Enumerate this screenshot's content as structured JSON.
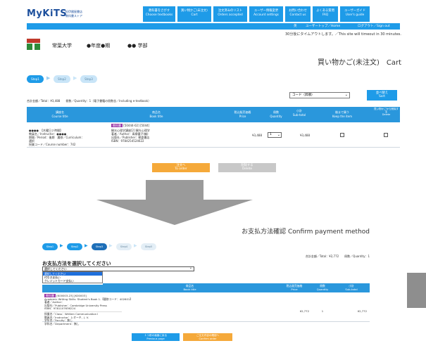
{
  "header": {
    "logo_text": "MyKiTS",
    "logo_sub": [
      "紀伊國屋書店",
      "教科書ストア"
    ],
    "nav": [
      {
        "label": "教科書をさがす\nChoose textbooks"
      },
      {
        "label": "買い物かご(未注文)\nCart"
      },
      {
        "label": "注文済みのリスト\nOrders accepted"
      },
      {
        "label": "ユーザー情報変更\nAccount settings"
      },
      {
        "label": "お問い合わせ\nContact us"
      },
      {
        "label": "よくある質問\nFAQ"
      },
      {
        "label": "ユーザーガイド\nUser's guide"
      }
    ],
    "subnav": [
      "英",
      "ユーザートップ／Home",
      "ログアウト／Sign out"
    ]
  },
  "timeout_notice": "30分後にタイムアウトします。／This site will timeout in 30 minutes.",
  "school": {
    "name": "常葉大学",
    "term": "●年度●期",
    "faculty": "●● 学部"
  },
  "cart_page": {
    "title": "買い物かご(未注文)　Cart",
    "steps": [
      "Step1",
      "Step2",
      "Step3"
    ],
    "sort_select": "コード（昇順）",
    "sort_button": "並べ替え\nSort",
    "total_line": "合計金額／Total：¥3,488　　冊数／Quantity：1（電子書籍の冊数含／Including e-textbook）",
    "columns": [
      "講座名\nCourse title",
      "商品名\nBook title",
      "税込販売価格\nPrice",
      "冊数\nQuantity",
      "小計\nSub-total",
      "後まで買う\nKeep the item",
      "買い物かごから削除する\nDelete"
    ],
    "row": {
      "course": [
        "●●●●　【木曜日２時間】",
        "教員名／Instructor：●●●●",
        "期間／Period：後期　履修／Curriculum：",
        "選択",
        "授業コード／Course number：742"
      ],
      "badge": "教科書",
      "codes": "[50444-02] [5044]",
      "book": [
        "観光心理学講座[2] 観光心理学",
        "著者／Author：青柳優子(編)",
        "出版社／Publisher：朝倉書店",
        "ISBN：9784254524622"
      ],
      "price": "¥3,488",
      "qty": "1",
      "subtotal": "¥3,488"
    },
    "order_button": "注文へ\nTo order",
    "delete_button": "削除する\nDelete"
  },
  "payment_page": {
    "title": "お支払方法確認 Confirm payment method",
    "steps": [
      "Step1",
      "Step2",
      "Step3",
      "Step4",
      "Step5"
    ],
    "total_line": "合計金額／Total：¥2,772　　冊数／Quantity：1",
    "select_heading": "お支払方法を選択してください",
    "select_value": "選択してください",
    "options": [
      "選択してください",
      "代引き支払い",
      "クレジットカード支払い"
    ],
    "columns": [
      "商品名\nBook title",
      "税込販売価格\nPrice",
      "冊数\nQuantity",
      "小計\nSub-total"
    ],
    "row": {
      "badge": "教科書",
      "codes": "[K00003-23] [K00003]",
      "book": [
        "Academic Writing Skills: Student's Book 1.【履修コード：402601】",
        "著者／Author：",
        "出版社／Publisher：Cambridge University Press",
        "ISBN：9781107636224"
      ],
      "class": [
        "授業名／Class：Written Communication I",
        "教員名／Instructor：レオーキ、J. V.",
        "学年名／Faculty：無し",
        "学科名／Department：無し"
      ],
      "price": "¥2,772",
      "qty": "1",
      "subtotal": "¥2,772"
    },
    "prev_button": "１つ前の画面に戻る\nPrevious page",
    "confirm_button": "ご注文内容の確認へ\nConfirm order"
  },
  "colors": {
    "nav_blue": "#1e9be8",
    "orange": "#f5a93a",
    "gray_button": "#c8c8c8",
    "logo_green": "#2e8b3a",
    "logo_red": "#c0392b",
    "badge_purple": "#9a3aa8",
    "arrow_gray": "#9a9a9a"
  }
}
